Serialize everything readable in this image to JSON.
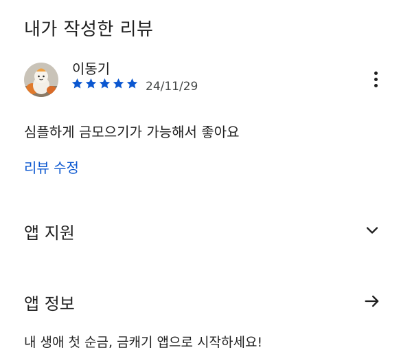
{
  "section": {
    "title": "내가 작성한 리뷰"
  },
  "review": {
    "reviewer_name": "이동기",
    "rating": 5,
    "rating_max": 5,
    "date": "24/11/29",
    "body": "심플하게 금모으기가 가능해서 좋아요",
    "edit_label": "리뷰 수정",
    "star_color": "#0b57d0"
  },
  "more_menu": {
    "icon": "more-vert-icon"
  },
  "app_support": {
    "label": "앱 지원",
    "icon": "chevron-down-icon"
  },
  "app_info": {
    "label": "앱 정보",
    "icon": "arrow-right-icon",
    "tagline": "내 생애 첫 순금, 금캐기 앱으로 시작하세요!"
  },
  "colors": {
    "link": "#0b57d0",
    "text": "#1f1f1f",
    "secondary_text": "#444746"
  }
}
